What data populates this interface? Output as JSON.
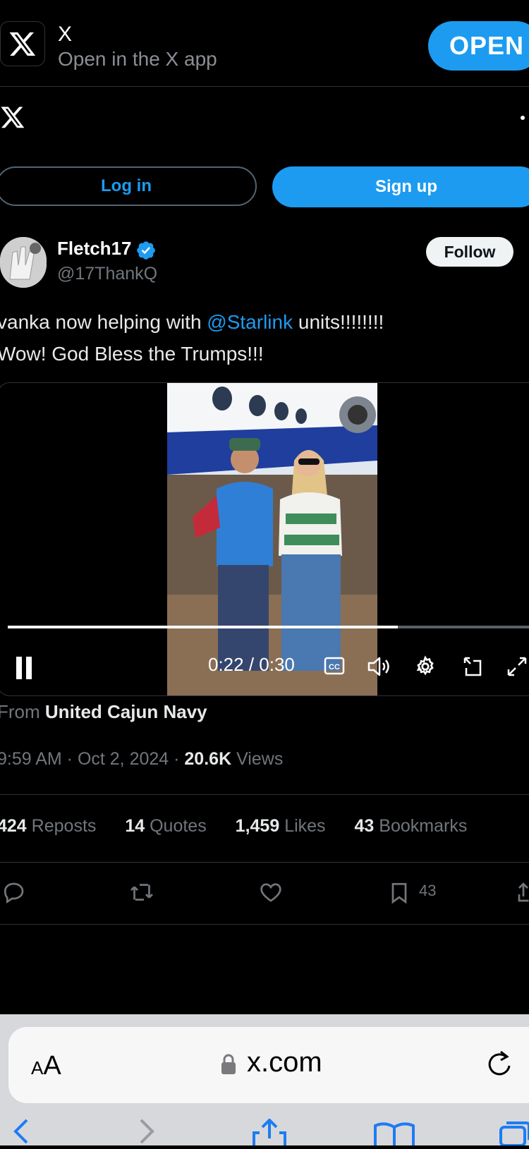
{
  "banner": {
    "app_name": "X",
    "subtitle": "Open in the X app",
    "open_label": "OPEN"
  },
  "auth": {
    "login_label": "Log in",
    "signup_label": "Sign up"
  },
  "post": {
    "author_name": "Fletch17",
    "author_handle": "@17ThankQ",
    "follow_label": "Follow",
    "text_line1_before": "vanka now helping with ",
    "mention": "@Starlink",
    "text_line1_after": " units!!!!!!!!",
    "text_line2": "Wow! God Bless the Trumps!!!",
    "video": {
      "time_label": "0:22 / 0:30",
      "progress": 0.727
    },
    "source_prefix": "From",
    "source_name": "United Cajun Navy",
    "timestamp": "9:59 AM · Oct 2, 2024 · ",
    "views_count": "20.6K",
    "views_label": "Views",
    "stats": [
      {
        "count": "424",
        "label": "Reposts"
      },
      {
        "count": "14",
        "label": "Quotes"
      },
      {
        "count": "1,459",
        "label": "Likes"
      },
      {
        "count": "43",
        "label": "Bookmarks"
      }
    ],
    "bookmark_count": "43"
  },
  "browser": {
    "aa_small": "A",
    "aa_large": "A",
    "url": "x.com"
  },
  "colors": {
    "accent": "#1d9bf0",
    "background": "#000000",
    "muted": "#71767b"
  }
}
